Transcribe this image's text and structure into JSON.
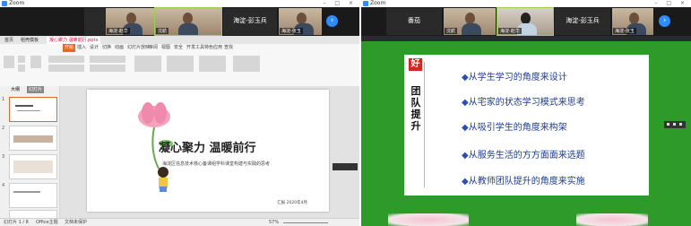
{
  "app": {
    "title": "Zoom"
  },
  "left_gallery": {
    "tiles": [
      {
        "name": "番茄",
        "tag": ""
      },
      {
        "name": "",
        "tag": "海淀-赵华"
      },
      {
        "name": "",
        "tag": "沈航"
      },
      {
        "name": "海淀-彭玉兵",
        "tag": ""
      },
      {
        "name": "",
        "tag": "海淀-张玉"
      }
    ]
  },
  "right_gallery": {
    "tiles": [
      {
        "name": "番茄",
        "tag": ""
      },
      {
        "name": "",
        "tag": "沈航"
      },
      {
        "name": "",
        "tag": "海淀-赵华"
      },
      {
        "name": "海淀-彭玉兵",
        "tag": ""
      },
      {
        "name": "",
        "tag": "海淀-张玉"
      }
    ]
  },
  "wps": {
    "doc_tabs": [
      "首页",
      "稻壳模板",
      "凝心聚力 温暖前行.pptx"
    ],
    "ribbon_tabs": [
      "开始",
      "插入",
      "设计",
      "切换",
      "动画",
      "幻灯片放映",
      "审阅",
      "视图",
      "安全",
      "开发工具",
      "特色应用",
      "查找"
    ],
    "sidebar_tabs": [
      "大纲",
      "幻灯片"
    ],
    "slide": {
      "title": "凝心聚力 温暖前行",
      "subtitle": "海淀区信息技术核心备课组学科课堂构建与实践的思考",
      "footer": "汇报 2020年4月"
    },
    "status": {
      "slide_info": "幻灯片 1 / 8",
      "theme": "Office主题",
      "protect": "文档未保护",
      "zoom": "57%"
    }
  },
  "presentation": {
    "badge": "好",
    "vertical_title": "团队提升",
    "bullets": [
      "从学生学习的角度来设计",
      "从宅家的状态学习模式来思考",
      "从吸引学生的角度来构架",
      "从服务生活的方方面面来选题",
      "从教师团队提升的角度来实施"
    ]
  },
  "colors": {
    "zoom_blue": "#2d8cff",
    "slide_green": "#2e9a2a",
    "wps_orange": "#e06a2d",
    "bullet_blue": "#1c3c8e"
  }
}
